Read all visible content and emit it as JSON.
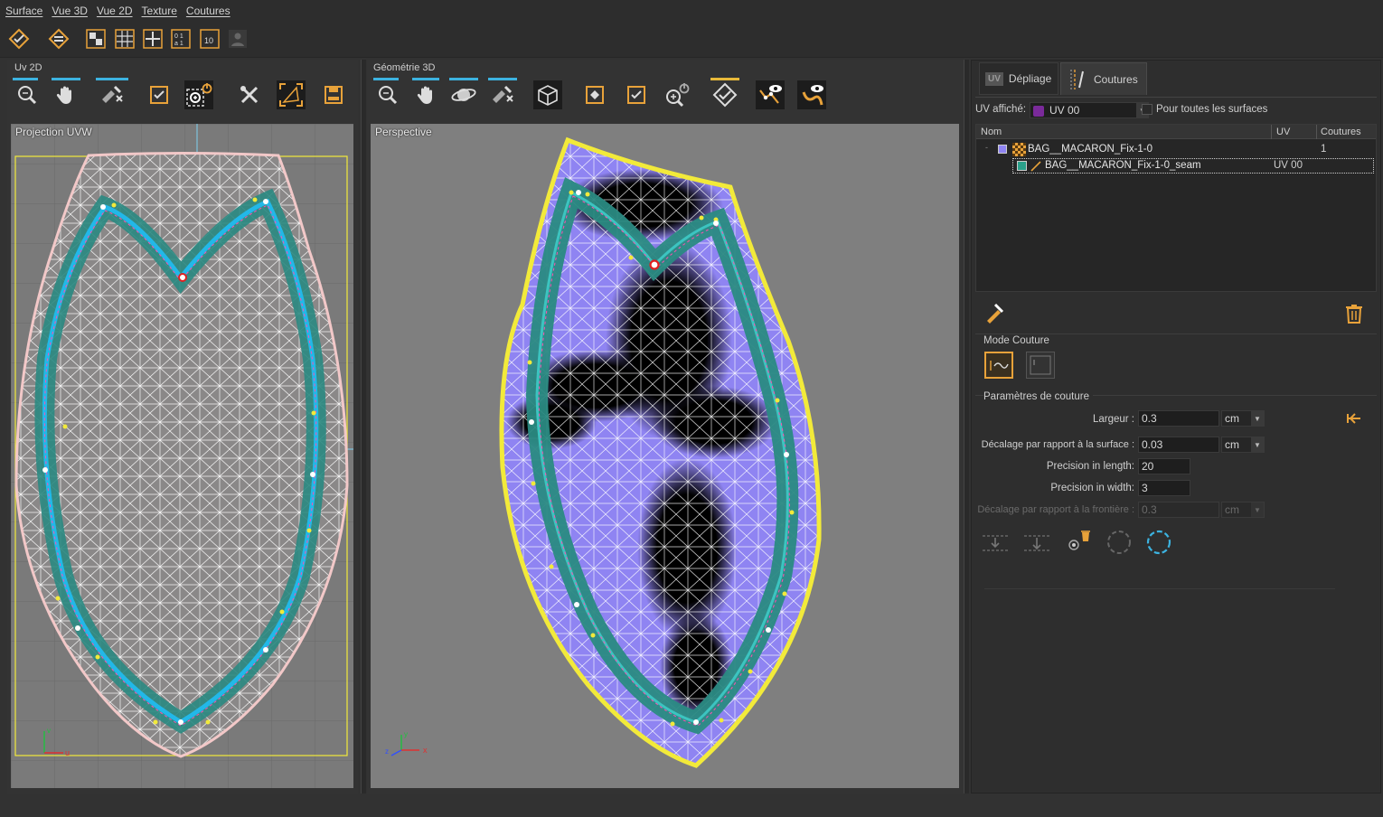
{
  "menu": [
    "Surface",
    "Vue 3D",
    "Vue 2D",
    "Texture",
    "Coutures"
  ],
  "main_toolbar": {
    "icons": [
      "seam-validate-icon",
      "seam-validate-alt-icon",
      "checker-texture-icon",
      "grid-icon",
      "cross-icon",
      "binary-01-icon",
      "number-10-icon",
      "user-icon"
    ]
  },
  "uv2d": {
    "panel_title": "Uv 2D",
    "viewport_title": "Projection UVW",
    "axis_x": "u",
    "axis_y": "v",
    "tools": [
      "zoom-icon",
      "pan-hand-icon",
      "select-edit-icon",
      "validate-icon",
      "zoom-fit-power-icon",
      "tools-icon",
      "frame-select-icon",
      "save-icon"
    ]
  },
  "geo3d": {
    "panel_title": "Géométrie 3D",
    "viewport_title": "Perspective",
    "axis_x": "x",
    "axis_y": "y",
    "axis_z": "z",
    "tools": [
      "zoom-icon",
      "pan-hand-icon",
      "orbit-icon",
      "select-edit-icon",
      "cube-icon",
      "frame-icon",
      "validate-icon",
      "zoom-fit-power-icon",
      "seam-validate-icon",
      "eye-path-icon",
      "eye-curve-icon"
    ]
  },
  "right": {
    "tabs": [
      {
        "label": "Dépliage",
        "icon": "uv-icon"
      },
      {
        "label": "Coutures",
        "icon": "seam-tab-icon"
      }
    ],
    "uv_label": "UV affiché:",
    "uv_value": "UV 00",
    "all_surfaces_label": "Pour toutes les surfaces",
    "table_headers": [
      "Nom",
      "UV",
      "Coutures"
    ],
    "rows": [
      {
        "name": "BAG__MACARON_Fix-1-0",
        "uv": "",
        "seams": "1"
      },
      {
        "name": "BAG__MACARON_Fix-1-0_seam",
        "uv": "UV 00",
        "seams": ""
      }
    ],
    "mode_label": "Mode Couture",
    "params_label": "Paramètres de couture",
    "params": [
      {
        "label": "Largeur :",
        "value": "0.3",
        "unit": "cm"
      },
      {
        "label": "Décalage par rapport à la surface :",
        "value": "0.03",
        "unit": "cm"
      },
      {
        "label": "Precision in length:",
        "value": "20",
        "unit": ""
      },
      {
        "label": "Precision in width:",
        "value": "3",
        "unit": ""
      },
      {
        "label": "Décalage par rapport à la frontière :",
        "value": "0.3",
        "unit": "cm"
      }
    ]
  },
  "colors": {
    "accent": "#e8a23a",
    "blue_line": "#3cb3e0",
    "yellow": "#f2ea3a",
    "seam_cyan": "#22b8e8",
    "mesh": "#ffffff",
    "surface": "#8f84f2"
  }
}
